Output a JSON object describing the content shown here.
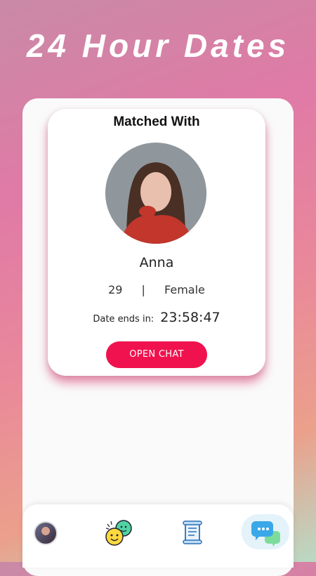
{
  "banner": {
    "title": "24 Hour Dates"
  },
  "match_card": {
    "heading": "Matched With",
    "name": "Anna",
    "age": "29",
    "separator": "|",
    "gender": "Female",
    "date_ends_label": "Date ends in:",
    "countdown": "23:58:47",
    "open_chat_label": "OPEN CHAT"
  },
  "colors": {
    "accent": "#f0124e",
    "shadow_pink": "#d63a6e"
  },
  "bottom_nav": {
    "items": [
      {
        "icon": "profile-photo-icon"
      },
      {
        "icon": "smiley-faces-icon"
      },
      {
        "icon": "scroll-document-icon"
      },
      {
        "icon": "chat-bubbles-icon",
        "selected": true
      }
    ]
  }
}
